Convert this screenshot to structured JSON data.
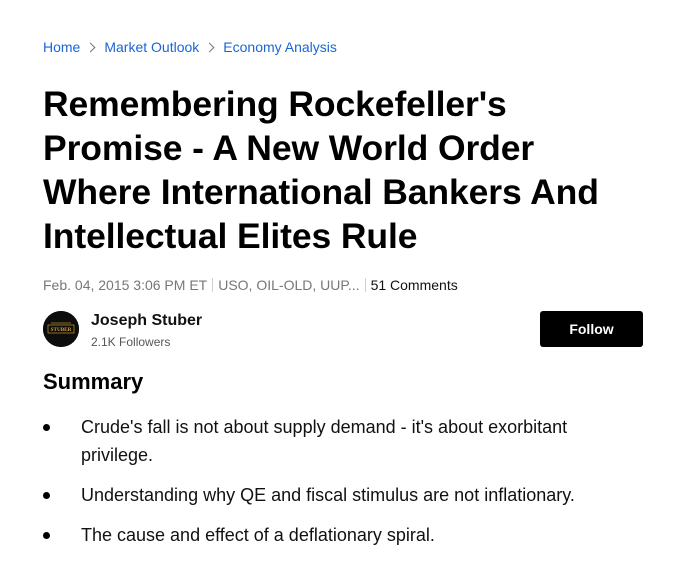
{
  "breadcrumb": {
    "items": [
      {
        "label": "Home"
      },
      {
        "label": "Market Outlook"
      },
      {
        "label": "Economy Analysis"
      }
    ]
  },
  "article": {
    "title": "Remembering Rockefeller's Promise - A New World Order Where International Bankers And Intellectual Elites Rule",
    "date": "Feb. 04, 2015 3:06 PM ET",
    "tickers": "USO, OIL-OLD, UUP...",
    "comments": "51 Comments"
  },
  "author": {
    "name": "Joseph Stuber",
    "followers": "2.1K Followers",
    "avatar_text": "STUBER"
  },
  "follow_button": {
    "label": "Follow"
  },
  "summary": {
    "heading": "Summary",
    "items": [
      "Crude's fall is not about supply demand - it's about exorbitant privilege.",
      "Understanding why QE and fiscal stimulus are not inflationary.",
      "The cause and effect of a deflationary spiral."
    ]
  },
  "colors": {
    "link": "#1a66d6",
    "meta_text": "#777777",
    "button_bg": "#000000"
  }
}
